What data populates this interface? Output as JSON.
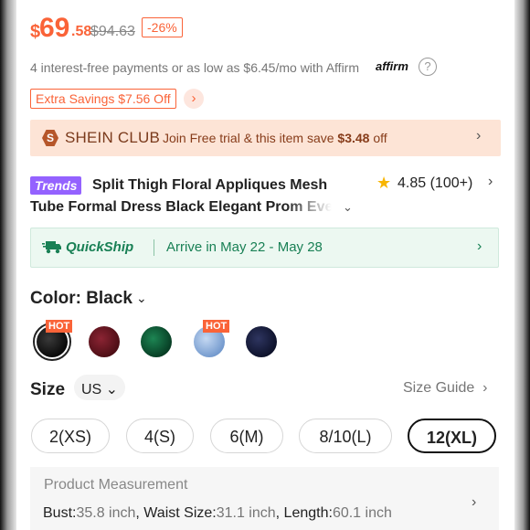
{
  "price": {
    "currency": "$",
    "integer": "69",
    "decimal": ".58",
    "original": "$94.63",
    "discount": "-26%",
    "color": "#fa6338"
  },
  "affirm": {
    "text": "4 interest-free payments or as low as $6.45/mo with Affirm",
    "logo": "affirm",
    "icon": "info-circle-icon"
  },
  "savings": {
    "label": "Extra Savings $7.56 Off",
    "arrow": "›"
  },
  "club": {
    "badge": "S",
    "name": "SHEIN CLUB",
    "text_prefix": "Join Free trial & this item save ",
    "text_amount": "$3.48",
    "text_suffix": " off",
    "arrow": "›"
  },
  "product": {
    "badge": "Trends",
    "title_line1": "Split Thigh Floral Appliques Mesh",
    "title_line2": "Tube Formal Dress Black Elegant Prom Even",
    "rating": "4.85",
    "reviews": "(100+)",
    "arrow": "›"
  },
  "quickship": {
    "label": "QuickShip",
    "text": "Arrive in May 22 - May 28",
    "arrow": "›",
    "color": "#198055"
  },
  "color": {
    "label": "Color: Black",
    "hot_label": "HOT",
    "swatches": [
      {
        "name": "Black",
        "hex": "#141414",
        "hot": true,
        "selected": true
      },
      {
        "name": "Burgundy",
        "hex": "#6a1620",
        "hot": false
      },
      {
        "name": "Green",
        "hex": "#0c5a36",
        "hot": false
      },
      {
        "name": "Light Blue",
        "hex": "#8fb3e0",
        "hot": true
      },
      {
        "name": "Navy",
        "hex": "#1a1f3c",
        "hot": false
      }
    ]
  },
  "size": {
    "label": "Size",
    "unit": "US",
    "guide": "Size Guide",
    "options": [
      "2(XS)",
      "4(S)",
      "6(M)",
      "8/10(L)",
      "12(XL)"
    ],
    "selected": "12(XL)"
  },
  "measurement": {
    "title": "Product Measurement",
    "bust_label": "Bust:",
    "bust_value": "35.8 inch",
    "waist_label": "Waist Size:",
    "waist_value": "31.1 inch",
    "length_label": "Length:",
    "length_value": "60.1 inch"
  }
}
